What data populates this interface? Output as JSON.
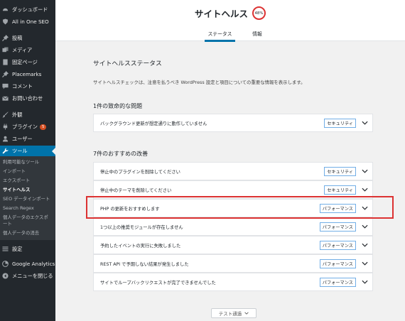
{
  "sidebar": {
    "items": [
      {
        "label": "ダッシュボード",
        "icon": "dashboard-icon"
      },
      {
        "label": "All in One SEO",
        "icon": "shield-icon"
      },
      {
        "label": "投稿",
        "icon": "pin-icon"
      },
      {
        "label": "メディア",
        "icon": "media-icon"
      },
      {
        "label": "固定ページ",
        "icon": "page-icon"
      },
      {
        "label": "Placemarks",
        "icon": "pin-icon"
      },
      {
        "label": "コメント",
        "icon": "comment-icon"
      },
      {
        "label": "お問い合わせ",
        "icon": "mail-icon"
      },
      {
        "label": "外観",
        "icon": "brush-icon"
      },
      {
        "label": "プラグイン",
        "icon": "plugin-icon",
        "badge": "5"
      },
      {
        "label": "ユーザー",
        "icon": "user-icon"
      },
      {
        "label": "ツール",
        "icon": "wrench-icon"
      },
      {
        "label": "設定",
        "icon": "settings-icon"
      },
      {
        "label": "Google Analytics",
        "icon": "analytics-icon"
      },
      {
        "label": "メニューを閉じる",
        "icon": "collapse-icon"
      }
    ],
    "submenu": [
      {
        "label": "利用可能なツール"
      },
      {
        "label": "インポート"
      },
      {
        "label": "エクスポート"
      },
      {
        "label": "サイトヘルス"
      },
      {
        "label": "SEO データインポート"
      },
      {
        "label": "Search Regex"
      },
      {
        "label": "個人データのエクスポート"
      },
      {
        "label": "個人データの消去"
      }
    ]
  },
  "header": {
    "title": "サイトヘルス",
    "score": "48%",
    "tabs": [
      {
        "label": "ステータス"
      },
      {
        "label": "情報"
      }
    ]
  },
  "main": {
    "section_title": "サイトヘルスステータス",
    "description": "サイトヘルスチェックは、注意を払うべき WordPress 設定と項目についての重要な情報を表示します。",
    "critical": {
      "title": "1件の致命的な問題",
      "items": [
        {
          "label": "バックグラウンド更新が想定通りに動作していません",
          "tag": "セキュリティ"
        }
      ]
    },
    "recommended": {
      "title": "7件のおすすめの改善",
      "items": [
        {
          "label": "停止中のプラグインを削除してください",
          "tag": "セキュリティ"
        },
        {
          "label": "停止中のテーマを削除してください",
          "tag": "セキュリティ"
        },
        {
          "label": "PHP の更新をおすすめします",
          "tag": "パフォーマンス"
        },
        {
          "label": "1つ以上の推奨モジュールが存在しません",
          "tag": "パフォーマンス"
        },
        {
          "label": "予約したイベントの実行に失敗しました",
          "tag": "パフォーマンス"
        },
        {
          "label": "REST API で予期しない結果が発生しました",
          "tag": "パフォーマンス"
        },
        {
          "label": "サイトでループバックリクエストが完了できませんでした",
          "tag": "パフォーマンス"
        }
      ]
    },
    "passed_button": "テスト通過"
  },
  "colors": {
    "accent": "#0073aa",
    "sidebar_bg": "#23282d",
    "critical": "#dc3232",
    "tag_border": "#72aee6"
  }
}
